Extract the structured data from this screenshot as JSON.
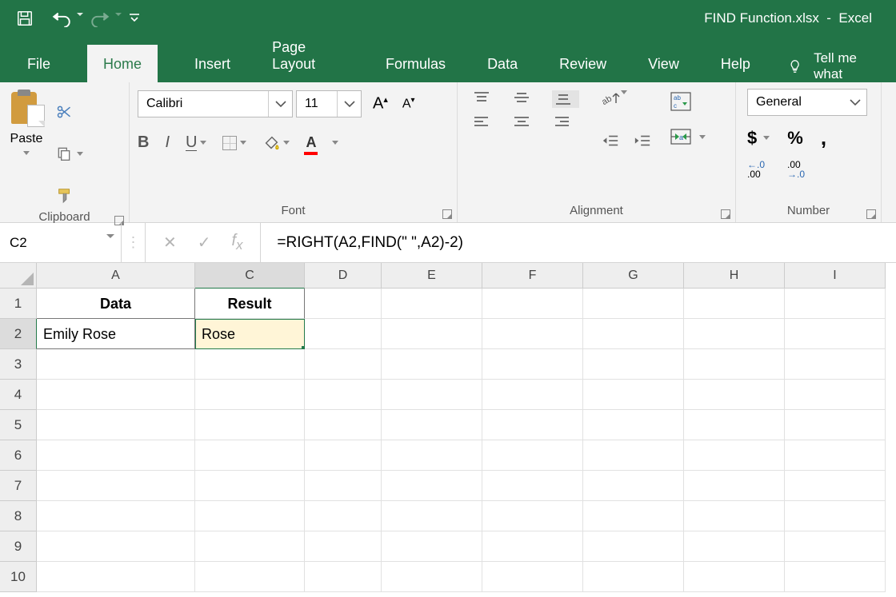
{
  "title": {
    "doc": "FIND Function.xlsx",
    "app": "Excel"
  },
  "tabs": {
    "file": "File",
    "home": "Home",
    "insert": "Insert",
    "page_layout": "Page Layout",
    "formulas": "Formulas",
    "data": "Data",
    "review": "Review",
    "view": "View",
    "help": "Help",
    "tell_me": "Tell me what"
  },
  "ribbon": {
    "clipboard": {
      "paste": "Paste",
      "label": "Clipboard"
    },
    "font": {
      "name": "Calibri",
      "size": "11",
      "label": "Font"
    },
    "alignment": {
      "label": "Alignment"
    },
    "number": {
      "format": "General",
      "label": "Number"
    }
  },
  "namebox": "C2",
  "formula": "=RIGHT(A2,FIND(\" \",A2)-2)",
  "columns": [
    "A",
    "C",
    "D",
    "E",
    "F",
    "G",
    "H",
    "I"
  ],
  "rows": [
    "1",
    "2",
    "3",
    "4",
    "5",
    "6",
    "7",
    "8",
    "9",
    "10"
  ],
  "cells": {
    "A1": "Data",
    "C1": "Result",
    "A2": "Emily Rose",
    "C2": "Rose"
  }
}
